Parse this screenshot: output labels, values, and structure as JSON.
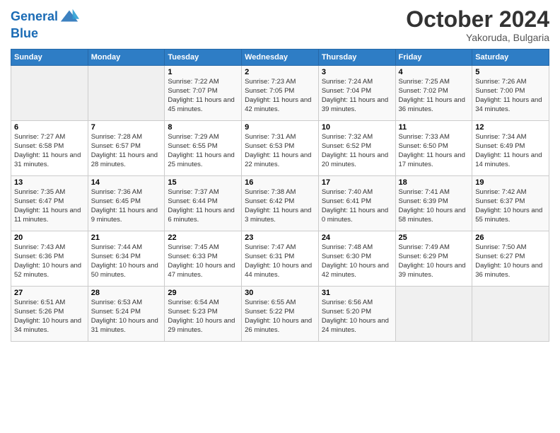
{
  "header": {
    "logo_line1": "General",
    "logo_line2": "Blue",
    "month": "October 2024",
    "location": "Yakoruda, Bulgaria"
  },
  "weekdays": [
    "Sunday",
    "Monday",
    "Tuesday",
    "Wednesday",
    "Thursday",
    "Friday",
    "Saturday"
  ],
  "weeks": [
    [
      {
        "day": "",
        "info": ""
      },
      {
        "day": "",
        "info": ""
      },
      {
        "day": "1",
        "info": "Sunrise: 7:22 AM\nSunset: 7:07 PM\nDaylight: 11 hours and 45 minutes."
      },
      {
        "day": "2",
        "info": "Sunrise: 7:23 AM\nSunset: 7:05 PM\nDaylight: 11 hours and 42 minutes."
      },
      {
        "day": "3",
        "info": "Sunrise: 7:24 AM\nSunset: 7:04 PM\nDaylight: 11 hours and 39 minutes."
      },
      {
        "day": "4",
        "info": "Sunrise: 7:25 AM\nSunset: 7:02 PM\nDaylight: 11 hours and 36 minutes."
      },
      {
        "day": "5",
        "info": "Sunrise: 7:26 AM\nSunset: 7:00 PM\nDaylight: 11 hours and 34 minutes."
      }
    ],
    [
      {
        "day": "6",
        "info": "Sunrise: 7:27 AM\nSunset: 6:58 PM\nDaylight: 11 hours and 31 minutes."
      },
      {
        "day": "7",
        "info": "Sunrise: 7:28 AM\nSunset: 6:57 PM\nDaylight: 11 hours and 28 minutes."
      },
      {
        "day": "8",
        "info": "Sunrise: 7:29 AM\nSunset: 6:55 PM\nDaylight: 11 hours and 25 minutes."
      },
      {
        "day": "9",
        "info": "Sunrise: 7:31 AM\nSunset: 6:53 PM\nDaylight: 11 hours and 22 minutes."
      },
      {
        "day": "10",
        "info": "Sunrise: 7:32 AM\nSunset: 6:52 PM\nDaylight: 11 hours and 20 minutes."
      },
      {
        "day": "11",
        "info": "Sunrise: 7:33 AM\nSunset: 6:50 PM\nDaylight: 11 hours and 17 minutes."
      },
      {
        "day": "12",
        "info": "Sunrise: 7:34 AM\nSunset: 6:49 PM\nDaylight: 11 hours and 14 minutes."
      }
    ],
    [
      {
        "day": "13",
        "info": "Sunrise: 7:35 AM\nSunset: 6:47 PM\nDaylight: 11 hours and 11 minutes."
      },
      {
        "day": "14",
        "info": "Sunrise: 7:36 AM\nSunset: 6:45 PM\nDaylight: 11 hours and 9 minutes."
      },
      {
        "day": "15",
        "info": "Sunrise: 7:37 AM\nSunset: 6:44 PM\nDaylight: 11 hours and 6 minutes."
      },
      {
        "day": "16",
        "info": "Sunrise: 7:38 AM\nSunset: 6:42 PM\nDaylight: 11 hours and 3 minutes."
      },
      {
        "day": "17",
        "info": "Sunrise: 7:40 AM\nSunset: 6:41 PM\nDaylight: 11 hours and 0 minutes."
      },
      {
        "day": "18",
        "info": "Sunrise: 7:41 AM\nSunset: 6:39 PM\nDaylight: 10 hours and 58 minutes."
      },
      {
        "day": "19",
        "info": "Sunrise: 7:42 AM\nSunset: 6:37 PM\nDaylight: 10 hours and 55 minutes."
      }
    ],
    [
      {
        "day": "20",
        "info": "Sunrise: 7:43 AM\nSunset: 6:36 PM\nDaylight: 10 hours and 52 minutes."
      },
      {
        "day": "21",
        "info": "Sunrise: 7:44 AM\nSunset: 6:34 PM\nDaylight: 10 hours and 50 minutes."
      },
      {
        "day": "22",
        "info": "Sunrise: 7:45 AM\nSunset: 6:33 PM\nDaylight: 10 hours and 47 minutes."
      },
      {
        "day": "23",
        "info": "Sunrise: 7:47 AM\nSunset: 6:31 PM\nDaylight: 10 hours and 44 minutes."
      },
      {
        "day": "24",
        "info": "Sunrise: 7:48 AM\nSunset: 6:30 PM\nDaylight: 10 hours and 42 minutes."
      },
      {
        "day": "25",
        "info": "Sunrise: 7:49 AM\nSunset: 6:29 PM\nDaylight: 10 hours and 39 minutes."
      },
      {
        "day": "26",
        "info": "Sunrise: 7:50 AM\nSunset: 6:27 PM\nDaylight: 10 hours and 36 minutes."
      }
    ],
    [
      {
        "day": "27",
        "info": "Sunrise: 6:51 AM\nSunset: 5:26 PM\nDaylight: 10 hours and 34 minutes."
      },
      {
        "day": "28",
        "info": "Sunrise: 6:53 AM\nSunset: 5:24 PM\nDaylight: 10 hours and 31 minutes."
      },
      {
        "day": "29",
        "info": "Sunrise: 6:54 AM\nSunset: 5:23 PM\nDaylight: 10 hours and 29 minutes."
      },
      {
        "day": "30",
        "info": "Sunrise: 6:55 AM\nSunset: 5:22 PM\nDaylight: 10 hours and 26 minutes."
      },
      {
        "day": "31",
        "info": "Sunrise: 6:56 AM\nSunset: 5:20 PM\nDaylight: 10 hours and 24 minutes."
      },
      {
        "day": "",
        "info": ""
      },
      {
        "day": "",
        "info": ""
      }
    ]
  ]
}
